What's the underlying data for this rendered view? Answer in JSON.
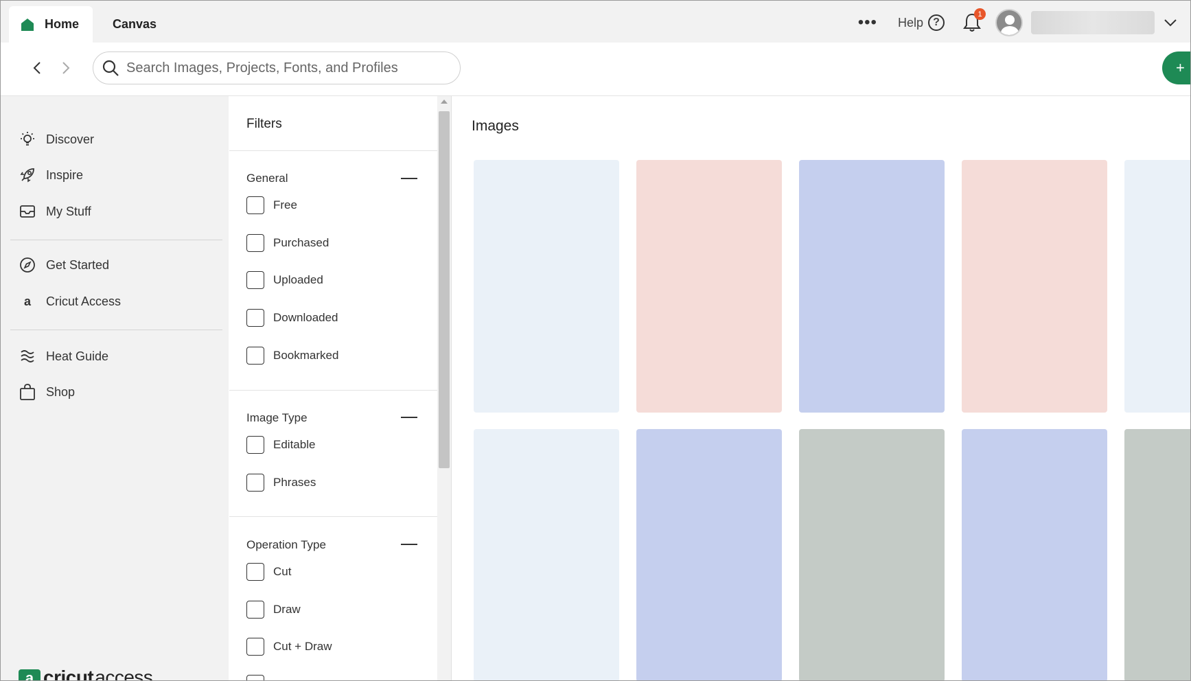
{
  "tabs": {
    "home": "Home",
    "canvas": "Canvas"
  },
  "header": {
    "help_label": "Help",
    "notification_count": "1"
  },
  "search": {
    "placeholder": "Search Images, Projects, Fonts, and Profiles"
  },
  "new_button": "+",
  "sidebar": {
    "items": [
      {
        "label": "Discover",
        "icon": "lightbulb-icon"
      },
      {
        "label": "Inspire",
        "icon": "rocket-icon"
      },
      {
        "label": "My Stuff",
        "icon": "inbox-icon"
      },
      {
        "label": "Get Started",
        "icon": "compass-icon"
      },
      {
        "label": "Cricut Access",
        "icon": "access-a-icon"
      },
      {
        "label": "Heat Guide",
        "icon": "heat-waves-icon"
      },
      {
        "label": "Shop",
        "icon": "shopping-bag-icon"
      }
    ],
    "access_logo": {
      "brand": "cricut",
      "product": "access"
    }
  },
  "filters": {
    "title": "Filters",
    "groups": [
      {
        "title": "General",
        "options": [
          "Free",
          "Purchased",
          "Uploaded",
          "Downloaded",
          "Bookmarked"
        ]
      },
      {
        "title": "Image Type",
        "options": [
          "Editable",
          "Phrases"
        ]
      },
      {
        "title": "Operation Type",
        "options": [
          "Cut",
          "Draw",
          "Cut + Draw"
        ]
      }
    ]
  },
  "main": {
    "title": "Images"
  },
  "colors": {
    "brand_green": "#1e8a55",
    "badge_orange": "#e8562a",
    "card_colors": [
      "#eaf1f8",
      "#f5dcd8",
      "#c5cfee",
      "#c4cbc6"
    ]
  }
}
